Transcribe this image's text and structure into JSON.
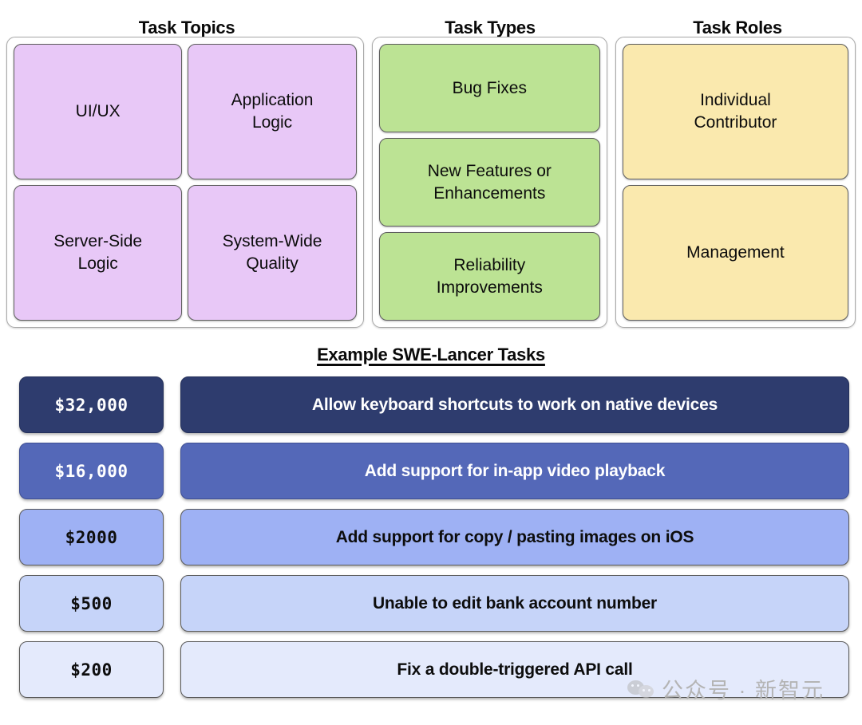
{
  "columns": [
    {
      "heading": "Task Topics",
      "color": "#e8c8f7",
      "cards": [
        "UI/UX",
        "Application\nLogic",
        "Server-Side\nLogic",
        "System-Wide\nQuality"
      ]
    },
    {
      "heading": "Task Types",
      "color": "#bce394",
      "cards": [
        "Bug Fixes",
        "New Features or\nEnhancements",
        "Reliability\nImprovements"
      ]
    },
    {
      "heading": "Task Roles",
      "color": "#fae9ae",
      "cards": [
        "Individual\nContributor",
        "Management"
      ]
    }
  ],
  "examples": {
    "title": "Example SWE-Lancer Tasks",
    "rows": [
      {
        "price": "$32,000",
        "description": "Allow keyboard shortcuts to work on native devices",
        "bg": "#2e3c6e",
        "text": "#ffffff"
      },
      {
        "price": "$16,000",
        "description": "Add support for in-app video playback",
        "bg": "#5468b8",
        "text": "#ffffff"
      },
      {
        "price": "$2000",
        "description": "Add support for copy / pasting images on iOS",
        "bg": "#9eb1f4",
        "text": "#0d0d0d"
      },
      {
        "price": "$500",
        "description": "Unable to edit bank account number",
        "bg": "#c6d4f9",
        "text": "#0d0d0d"
      },
      {
        "price": "$200",
        "description": "Fix a double-triggered API call",
        "bg": "#e4eafc",
        "text": "#0d0d0d"
      }
    ]
  },
  "watermark": {
    "text": "公众号 · 新智元",
    "icon": "wechat-logo"
  }
}
